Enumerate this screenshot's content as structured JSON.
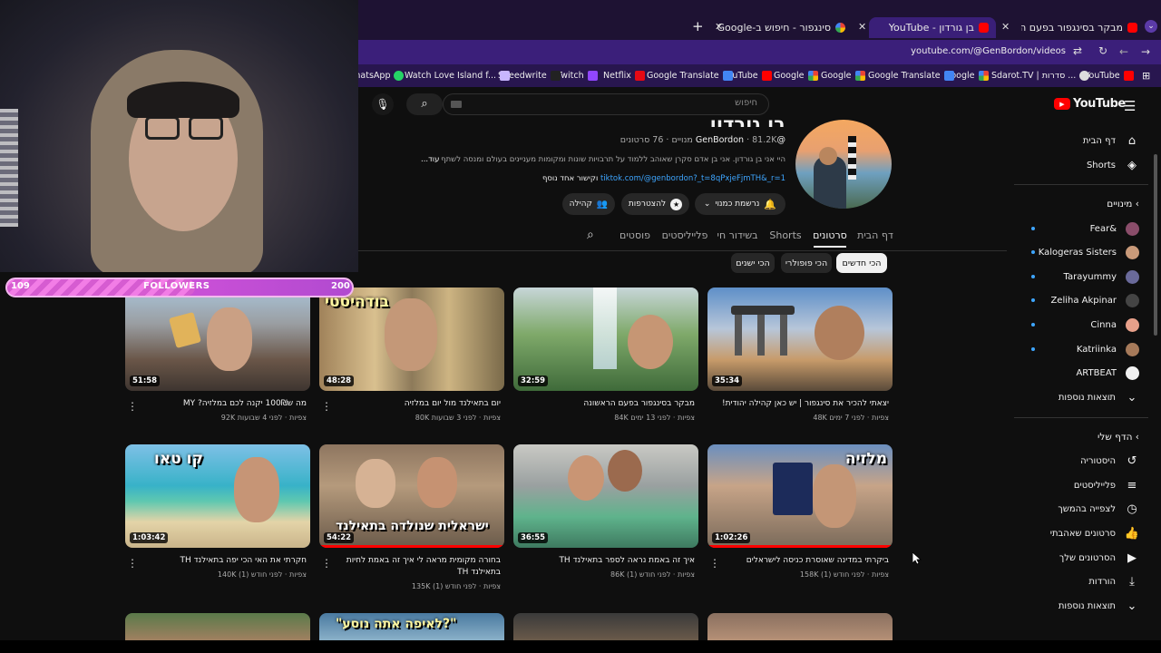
{
  "browser": {
    "tabs": [
      {
        "title": "מבקר בסינגפור בפעם הראשונה",
        "favicon": "youtube"
      },
      {
        "title": "בן גורדון - YouTube",
        "favicon": "youtube",
        "active": true
      },
      {
        "title": "סינגפור - חיפוש ב-Google",
        "favicon": "google"
      }
    ],
    "new_tab": "+",
    "url": "youtube.com/@GenBordon/videos",
    "bookmarks": [
      "WhatsApp",
      "Watch Love Island f...",
      "Speedwrite",
      "Twitch",
      "Netflix",
      "Google Translate",
      "YouTube",
      "Google",
      "Google",
      "Google Translate",
      "Google",
      "Sdarot.TV | סדרות ...",
      "YouTube"
    ]
  },
  "overlay": {
    "followers_label": "FOLLOWERS",
    "followers_current": "109",
    "followers_goal": "200",
    "followers_progress": 0.545
  },
  "youtube": {
    "logo": "YouTube",
    "search_placeholder": "חיפוש",
    "sidebar": {
      "main": [
        {
          "label": "דף הבית",
          "icon": "home-icon"
        },
        {
          "label": "Shorts",
          "icon": "shorts-icon"
        }
      ],
      "subs_title": "מינויים",
      "subs": [
        "Fear&",
        "Kalogeras Sisters",
        "Tarayummy",
        "Zeliha Akpinar",
        "Cinna",
        "Katriinka",
        "ARTBEAT"
      ],
      "show_more": "תוצאות נוספות",
      "you_title": "הדף שלי",
      "you": [
        {
          "label": "היסטוריה",
          "icon": "history-icon"
        },
        {
          "label": "פלייליסטים",
          "icon": "playlist-icon"
        },
        {
          "label": "לצפייה בהמשך",
          "icon": "clock-icon"
        },
        {
          "label": "סרטונים שאהבתי",
          "icon": "like-icon"
        },
        {
          "label": "הסרטונים שלך",
          "icon": "your-videos-icon"
        },
        {
          "label": "הורדות",
          "icon": "download-icon"
        }
      ],
      "show_more_2": "תוצאות נוספות"
    },
    "channel": {
      "name": "בן גורדון",
      "handle": "@GenBordon",
      "stats": "81.2K מנויים · 76 סרטונים",
      "description": "היי אני בן גורדון. אני בן אדם סקרן שאוהב ללמוד על תרבויות שונות ומקומות מעניינים בעולם ומנסה לשתף",
      "more": "...עוד",
      "link": "tiktok.com/@genbordon?_t=8qPxjeFjmTH&_r=1",
      "link_suffix": "וקישור אחד נוסף",
      "subscribed_btn": "נרשמת כמנוי",
      "join_btn": "להצטרפות",
      "community_btn": "קהילה"
    },
    "tabs": [
      "דף הבית",
      "סרטונים",
      "Shorts",
      "בשידור חי",
      "פלייליסטים",
      "פוסטים"
    ],
    "active_tab": "סרטונים",
    "chips": [
      "הכי חדשים",
      "הכי פופולרי",
      "הכי ישנים"
    ],
    "videos": [
      {
        "title": "יצאתי להכיר את סינגפור | יש כאן קהילה יהודית!",
        "views": "48K צפיות",
        "ago": "לפני 7 ימים",
        "duration": "35:34",
        "overlay": ""
      },
      {
        "title": "מבקר בסינגפור בפעם הראשונה",
        "views": "84K צפיות",
        "ago": "לפני 13 ימים",
        "duration": "32:59",
        "overlay": ""
      },
      {
        "title": "יום בתאילנד מול יום במלזיה",
        "views": "80K צפיות",
        "ago": "לפני 3 שבועות",
        "duration": "48:28",
        "overlay": "בודהיסטי"
      },
      {
        "title": "מה ש100₪ יקנה לכם במלזיה? MY",
        "views": "92K צפיות",
        "ago": "לפני 4 שבועות",
        "duration": "51:58",
        "overlay": ""
      },
      {
        "title": "ביקרתי במדינה שאוסרת כניסה לישראלים",
        "views": "158K צפיות",
        "ago": "לפני חודש (1)",
        "duration": "1:02:26",
        "overlay": "מלזיה"
      },
      {
        "title": "איך זה באמת נראה לספר בתאילנד TH",
        "views": "86K צפיות",
        "ago": "לפני חודש (1)",
        "duration": "36:55",
        "overlay": ""
      },
      {
        "title": "בחורה מקומית מראה לי איך זה באמת לחיות בתאילנד TH",
        "views": "135K צפיות",
        "ago": "לפני חודש (1)",
        "duration": "54:22",
        "overlay": "ישראלית שנולדה בתאילנד"
      },
      {
        "title": "חקרתי את האי הכי יפה בתאילנד TH",
        "views": "140K צפיות",
        "ago": "לפני חודש (1)",
        "duration": "1:03:42",
        "overlay": "קו טאו"
      }
    ],
    "row3_overlay": "\"לאיפה אתה נוסע?\""
  }
}
